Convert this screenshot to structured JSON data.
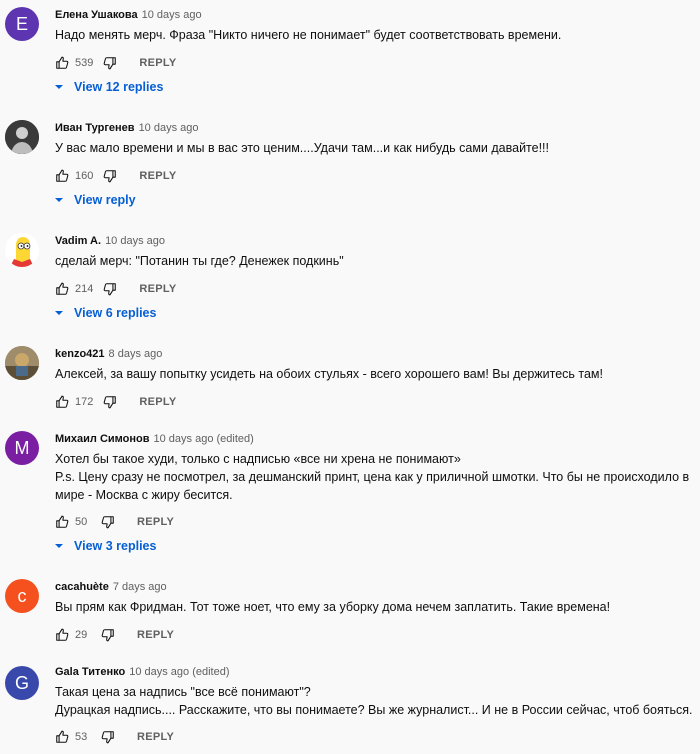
{
  "colors": {
    "avatar_e": "#5e35b1",
    "avatar_m": "#7b1fa2",
    "avatar_c": "#f4511e",
    "avatar_g": "#3949ab",
    "link": "#065fd4"
  },
  "icons": {
    "like": "thumb-up-icon",
    "dislike": "thumb-down-icon",
    "replies": "caret-down-icon"
  },
  "reply_label": "REPLY",
  "comments": [
    {
      "avatar_letter": "E",
      "author": "Елена Ушакова",
      "time": "10 days ago",
      "lines": [
        "Надо менять мерч. Фраза \"Никто ничего не понимает\" будет соответствовать времени."
      ],
      "likes": "539",
      "replies": "View 12 replies"
    },
    {
      "avatar_letter": "",
      "author": "Иван Тургенев",
      "time": "10 days ago",
      "lines": [
        "У вас мало времени и мы в вас это ценим....Удачи там...и как нибудь сами давайте!!!"
      ],
      "likes": "160",
      "replies": "View reply"
    },
    {
      "avatar_letter": "",
      "author": "Vadim A.",
      "time": "10 days ago",
      "lines": [
        "сделай мерч: \"Потанин ты где? Денежек подкинь\""
      ],
      "likes": "214",
      "replies": "View 6 replies"
    },
    {
      "avatar_letter": "",
      "author": "kenzo421",
      "time": "8 days ago",
      "lines": [
        "Алексей, за вашу попытку усидеть на обоих стульях - всего хорошего вам! Вы держитесь там!"
      ],
      "likes": "172",
      "replies": ""
    },
    {
      "avatar_letter": "M",
      "author": "Михаил Симонов",
      "time": "10 days ago (edited)",
      "lines": [
        "Хотел бы такое худи, только с надписью «все ни хрена не понимают»",
        "P.s. Цену сразу не посмотрел, за дешманский принт, цена как у приличной шмотки. Что бы не происходило в",
        "мире - Москва с жиру бесится."
      ],
      "likes": "50",
      "replies": "View 3 replies"
    },
    {
      "avatar_letter": "c",
      "author": "cacahuète",
      "time": "7 days ago",
      "lines": [
        "Вы прям как Фридман. Тот тоже ноет, что ему за уборку дома нечем заплатить. Такие времена!"
      ],
      "likes": "29",
      "replies": ""
    },
    {
      "avatar_letter": "G",
      "author": "Gala Титенко",
      "time": "10 days ago (edited)",
      "lines": [
        "Такая цена за надпись \"все всё понимают\"?",
        "Дурацкая надпись.... Расскажите, что вы понимаете? Вы же журналист... И не в России сейчас, чтоб бояться."
      ],
      "likes": "53",
      "replies": ""
    }
  ]
}
